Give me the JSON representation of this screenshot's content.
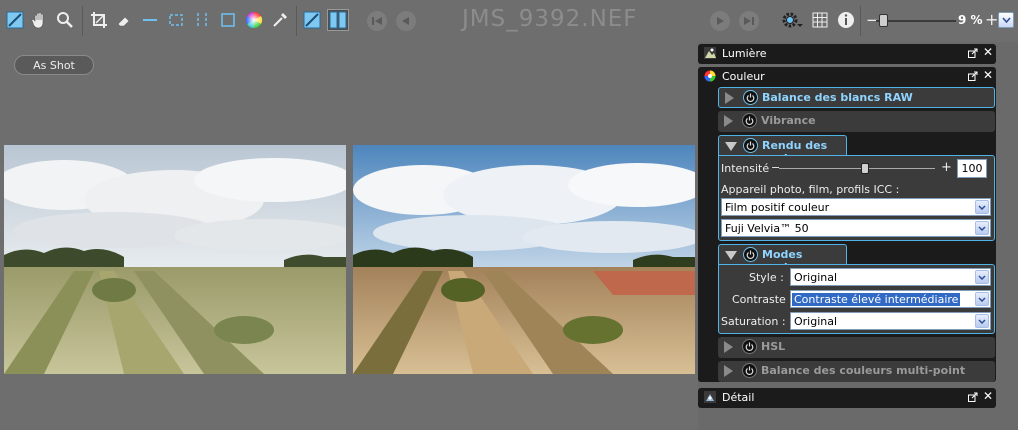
{
  "toolbar": {
    "file_title": "JMS_9392.NEF",
    "zoom": {
      "minus": "−",
      "value": "9 %",
      "plus": "+"
    }
  },
  "preview": {
    "white_balance_button": "As Shot"
  },
  "panel": {
    "lumiere": {
      "label": "Lumière"
    },
    "couleur": {
      "label": "Couleur",
      "sections": {
        "balance_raw": {
          "label": "Balance des blancs RAW"
        },
        "vibrance": {
          "label": "Vibrance"
        },
        "rendu": {
          "label": "Rendu des couleurs",
          "intensite_label": "Intensité",
          "intensite_minus": "−",
          "intensite_plus": "+",
          "intensite_value": "100",
          "intensite_level": 0.55,
          "icc_label": "Appareil photo, film, profils ICC :",
          "film_select": "Film positif couleur",
          "profile_select": "Fuji Velvia™ 50"
        },
        "modes": {
          "label": "Modes couleur",
          "style_label": "Style :",
          "style_value": "Original",
          "contraste_label": "Contraste",
          "contraste_value": "Contraste élevé intermédiaire",
          "saturation_label": "Saturation :",
          "saturation_value": "Original"
        },
        "hsl": {
          "label": "HSL"
        },
        "multipoint": {
          "label": "Balance des couleurs multi-point"
        }
      }
    },
    "detail": {
      "label": "Détail"
    }
  },
  "colors": {
    "accent": "#4fb3e8",
    "panel_bg": "#1b1b1b",
    "section_bg": "#3b3b3b",
    "active_text": "#8fd4ff"
  },
  "icons": [
    "compare-icon",
    "hand-icon",
    "zoom-icon",
    "crop-icon",
    "eraser-icon",
    "straighten-icon",
    "fit-icon",
    "fit-vertical-icon",
    "fit-both-icon",
    "color-wheel-icon",
    "eyedropper-icon",
    "single-view-icon",
    "split-view-icon",
    "first-image-icon",
    "prev-image-icon",
    "next-image-icon",
    "last-image-icon",
    "settings-icon",
    "grid-icon",
    "info-icon"
  ]
}
